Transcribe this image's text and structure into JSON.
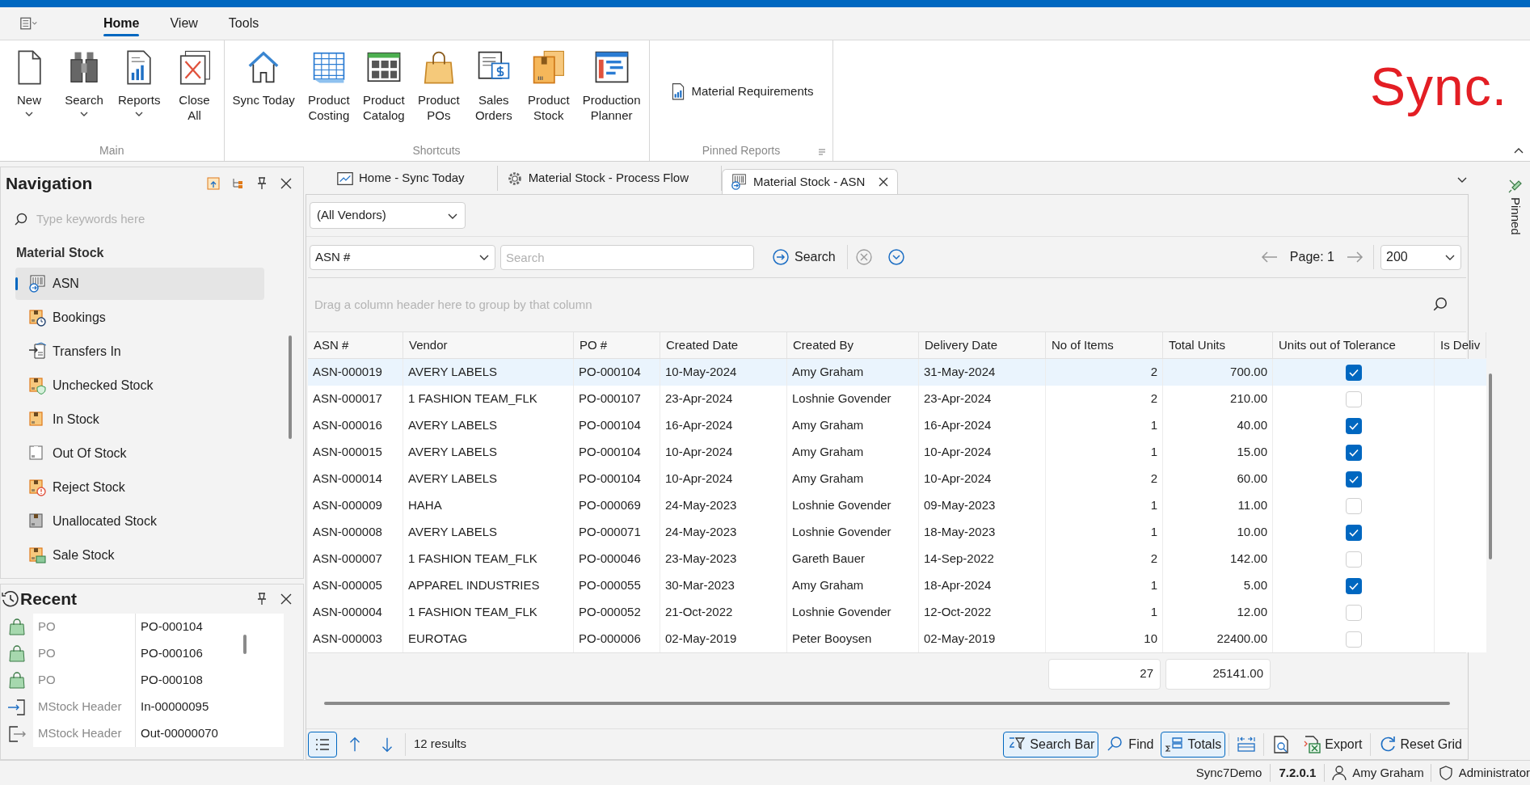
{
  "ribbon_tabs": [
    {
      "label": "Home",
      "selected": true
    },
    {
      "label": "View",
      "selected": false
    },
    {
      "label": "Tools",
      "selected": false
    }
  ],
  "ribbon": {
    "groups": [
      {
        "title": "Main",
        "launcher": false,
        "buttons": [
          {
            "label": [
              "New"
            ],
            "dropdown": true
          },
          {
            "label": [
              "Search"
            ],
            "dropdown": true
          },
          {
            "label": [
              "Reports"
            ],
            "dropdown": true
          },
          {
            "label": [
              "Close",
              "All"
            ],
            "dropdown": false
          }
        ]
      },
      {
        "title": "Shortcuts",
        "launcher": false,
        "buttons": [
          {
            "label": [
              "Sync Today"
            ],
            "dropdown": false
          },
          {
            "label": [
              "Product",
              "Costing"
            ],
            "dropdown": false
          },
          {
            "label": [
              "Product",
              "Catalog"
            ],
            "dropdown": false
          },
          {
            "label": [
              "Product",
              "POs"
            ],
            "dropdown": false
          },
          {
            "label": [
              "Sales",
              "Orders"
            ],
            "dropdown": false
          },
          {
            "label": [
              "Product",
              "Stock"
            ],
            "dropdown": false
          },
          {
            "label": [
              "Production",
              "Planner"
            ],
            "dropdown": false
          }
        ]
      },
      {
        "title": "Pinned Reports",
        "launcher": true,
        "buttons": [
          {
            "label": [
              "Material Requirements"
            ],
            "dropdown": false
          }
        ]
      }
    ],
    "logo": "Sync."
  },
  "navigation": {
    "title": "Navigation",
    "search": {
      "placeholder": "Type keywords here"
    },
    "section": "Material Stock",
    "items": [
      {
        "label": "ASN",
        "selected": true
      },
      {
        "label": "Bookings",
        "selected": false
      },
      {
        "label": "Transfers In",
        "selected": false
      },
      {
        "label": "Unchecked Stock",
        "selected": false
      },
      {
        "label": "In Stock",
        "selected": false
      },
      {
        "label": "Out Of Stock",
        "selected": false
      },
      {
        "label": "Reject Stock",
        "selected": false
      },
      {
        "label": "Unallocated Stock",
        "selected": false
      },
      {
        "label": "Sale Stock",
        "selected": false
      }
    ]
  },
  "recent": {
    "title": "Recent",
    "items": [
      {
        "kind": "po",
        "type": "PO",
        "ref": "PO-000104"
      },
      {
        "kind": "po",
        "type": "PO",
        "ref": "PO-000106"
      },
      {
        "kind": "po",
        "type": "PO",
        "ref": "PO-000108"
      },
      {
        "kind": "in",
        "type": "MStock Header",
        "ref": "In-00000095"
      },
      {
        "kind": "out",
        "type": "MStock Header",
        "ref": "Out-00000070"
      }
    ]
  },
  "document_tabs": [
    {
      "label": "Home - Sync Today",
      "selected": false
    },
    {
      "label": "Material Stock - Process Flow",
      "selected": false
    },
    {
      "label": "Material Stock - ASN",
      "selected": true
    }
  ],
  "vendor_filter": "(All Vendors)",
  "search_bar": {
    "field": "ASN #",
    "placeholder": "Search",
    "button": "Search",
    "page": "Page: 1",
    "page_size": "200"
  },
  "group_panel": "Drag a column header here to group by that column",
  "table": {
    "columns": [
      {
        "label": "ASN #",
        "kind": "text"
      },
      {
        "label": "Vendor",
        "kind": "text"
      },
      {
        "label": "PO #",
        "kind": "text"
      },
      {
        "label": "Created Date",
        "kind": "text"
      },
      {
        "label": "Created By",
        "kind": "text"
      },
      {
        "label": "Delivery Date",
        "kind": "text"
      },
      {
        "label": "No of Items",
        "kind": "number",
        "total": "27"
      },
      {
        "label": "Total Units",
        "kind": "number",
        "total": "25141.00"
      },
      {
        "label": "Units out of Tolerance",
        "kind": "check"
      },
      {
        "label": "Is Deliv",
        "kind": "blank"
      }
    ],
    "rows": [
      {
        "selected": true,
        "cells": [
          "ASN-000019",
          "AVERY LABELS",
          "PO-000104",
          "10-May-2024",
          "Amy Graham",
          "31-May-2024",
          "2",
          "700.00"
        ],
        "out_of_tolerance": true
      },
      {
        "selected": false,
        "cells": [
          "ASN-000017",
          "1 FASHION TEAM_FLK",
          "PO-000107",
          "23-Apr-2024",
          "Loshnie Govender",
          "23-Apr-2024",
          "2",
          "210.00"
        ],
        "out_of_tolerance": false
      },
      {
        "selected": false,
        "cells": [
          "ASN-000016",
          "AVERY LABELS",
          "PO-000104",
          "16-Apr-2024",
          "Amy Graham",
          "16-Apr-2024",
          "1",
          "40.00"
        ],
        "out_of_tolerance": true
      },
      {
        "selected": false,
        "cells": [
          "ASN-000015",
          "AVERY LABELS",
          "PO-000104",
          "10-Apr-2024",
          "Amy Graham",
          "10-Apr-2024",
          "1",
          "15.00"
        ],
        "out_of_tolerance": true
      },
      {
        "selected": false,
        "cells": [
          "ASN-000014",
          "AVERY LABELS",
          "PO-000104",
          "10-Apr-2024",
          "Amy Graham",
          "10-Apr-2024",
          "2",
          "60.00"
        ],
        "out_of_tolerance": true
      },
      {
        "selected": false,
        "cells": [
          "ASN-000009",
          "HAHA",
          "PO-000069",
          "24-May-2023",
          "Loshnie Govender",
          "09-May-2023",
          "1",
          "11.00"
        ],
        "out_of_tolerance": false
      },
      {
        "selected": false,
        "cells": [
          "ASN-000008",
          "AVERY LABELS",
          "PO-000071",
          "24-May-2023",
          "Loshnie Govender",
          "18-May-2023",
          "1",
          "10.00"
        ],
        "out_of_tolerance": true
      },
      {
        "selected": false,
        "cells": [
          "ASN-000007",
          "1 FASHION TEAM_FLK",
          "PO-000046",
          "23-May-2023",
          "Gareth Bauer",
          "14-Sep-2022",
          "2",
          "142.00"
        ],
        "out_of_tolerance": false
      },
      {
        "selected": false,
        "cells": [
          "ASN-000005",
          "APPAREL INDUSTRIES",
          "PO-000055",
          "30-Mar-2023",
          "Amy Graham",
          "18-Apr-2024",
          "1",
          "5.00"
        ],
        "out_of_tolerance": true
      },
      {
        "selected": false,
        "cells": [
          "ASN-000004",
          "1 FASHION TEAM_FLK",
          "PO-000052",
          "21-Oct-2022",
          "Loshnie Govender",
          "12-Oct-2022",
          "1",
          "12.00"
        ],
        "out_of_tolerance": false
      },
      {
        "selected": false,
        "cells": [
          "ASN-000003",
          "EUROTAG",
          "PO-000006",
          "02-May-2019",
          "Peter Booysen",
          "02-May-2019",
          "10",
          "22400.00"
        ],
        "out_of_tolerance": false
      }
    ]
  },
  "bottom_toolbar": {
    "results": "12 results",
    "tools": [
      {
        "kind": "searchbar",
        "label": "Search Bar",
        "active": true
      },
      {
        "kind": "find",
        "label": "Find",
        "active": false
      },
      {
        "kind": "totals",
        "label": "Totals",
        "active": true
      },
      {
        "kind": "fit",
        "active": false
      },
      {
        "kind": "preview",
        "active": false
      },
      {
        "kind": "export",
        "label": "Export",
        "active": false
      },
      {
        "kind": "reset",
        "label": "Reset Grid",
        "active": false
      }
    ]
  },
  "pinned_strip": "Pinned",
  "status_bar": {
    "database": "Sync7Demo",
    "version": "7.2.0.1",
    "user": "Amy Graham",
    "role": "Administrator"
  }
}
